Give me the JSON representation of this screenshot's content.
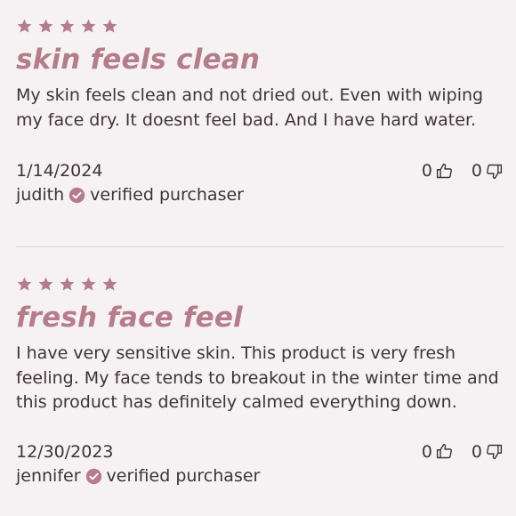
{
  "colors": {
    "accent": "#b57d8c",
    "text": "#3d3438",
    "background": "#f6f1f2",
    "divider": "#ddd3d6"
  },
  "reviews": [
    {
      "rating": 5,
      "title": "skin feels clean",
      "body": "My skin feels clean and not dried out. Even with wiping my face dry. It doesnt feel bad. And I have hard water.",
      "date": "1/14/2024",
      "author": "judith",
      "badge": "verified purchaser",
      "badge_icon": "check-circle-icon",
      "helpful": "0",
      "unhelpful": "0"
    },
    {
      "rating": 5,
      "title": "fresh face feel",
      "body": "I have very sensitive skin. This product is very fresh feeling. My face tends to breakout in the winter time and this product has definitely calmed everything down.",
      "date": "12/30/2023",
      "author": "jennifer",
      "badge": "verified purchaser",
      "badge_icon": "check-circle-icon",
      "helpful": "0",
      "unhelpful": "0"
    }
  ]
}
